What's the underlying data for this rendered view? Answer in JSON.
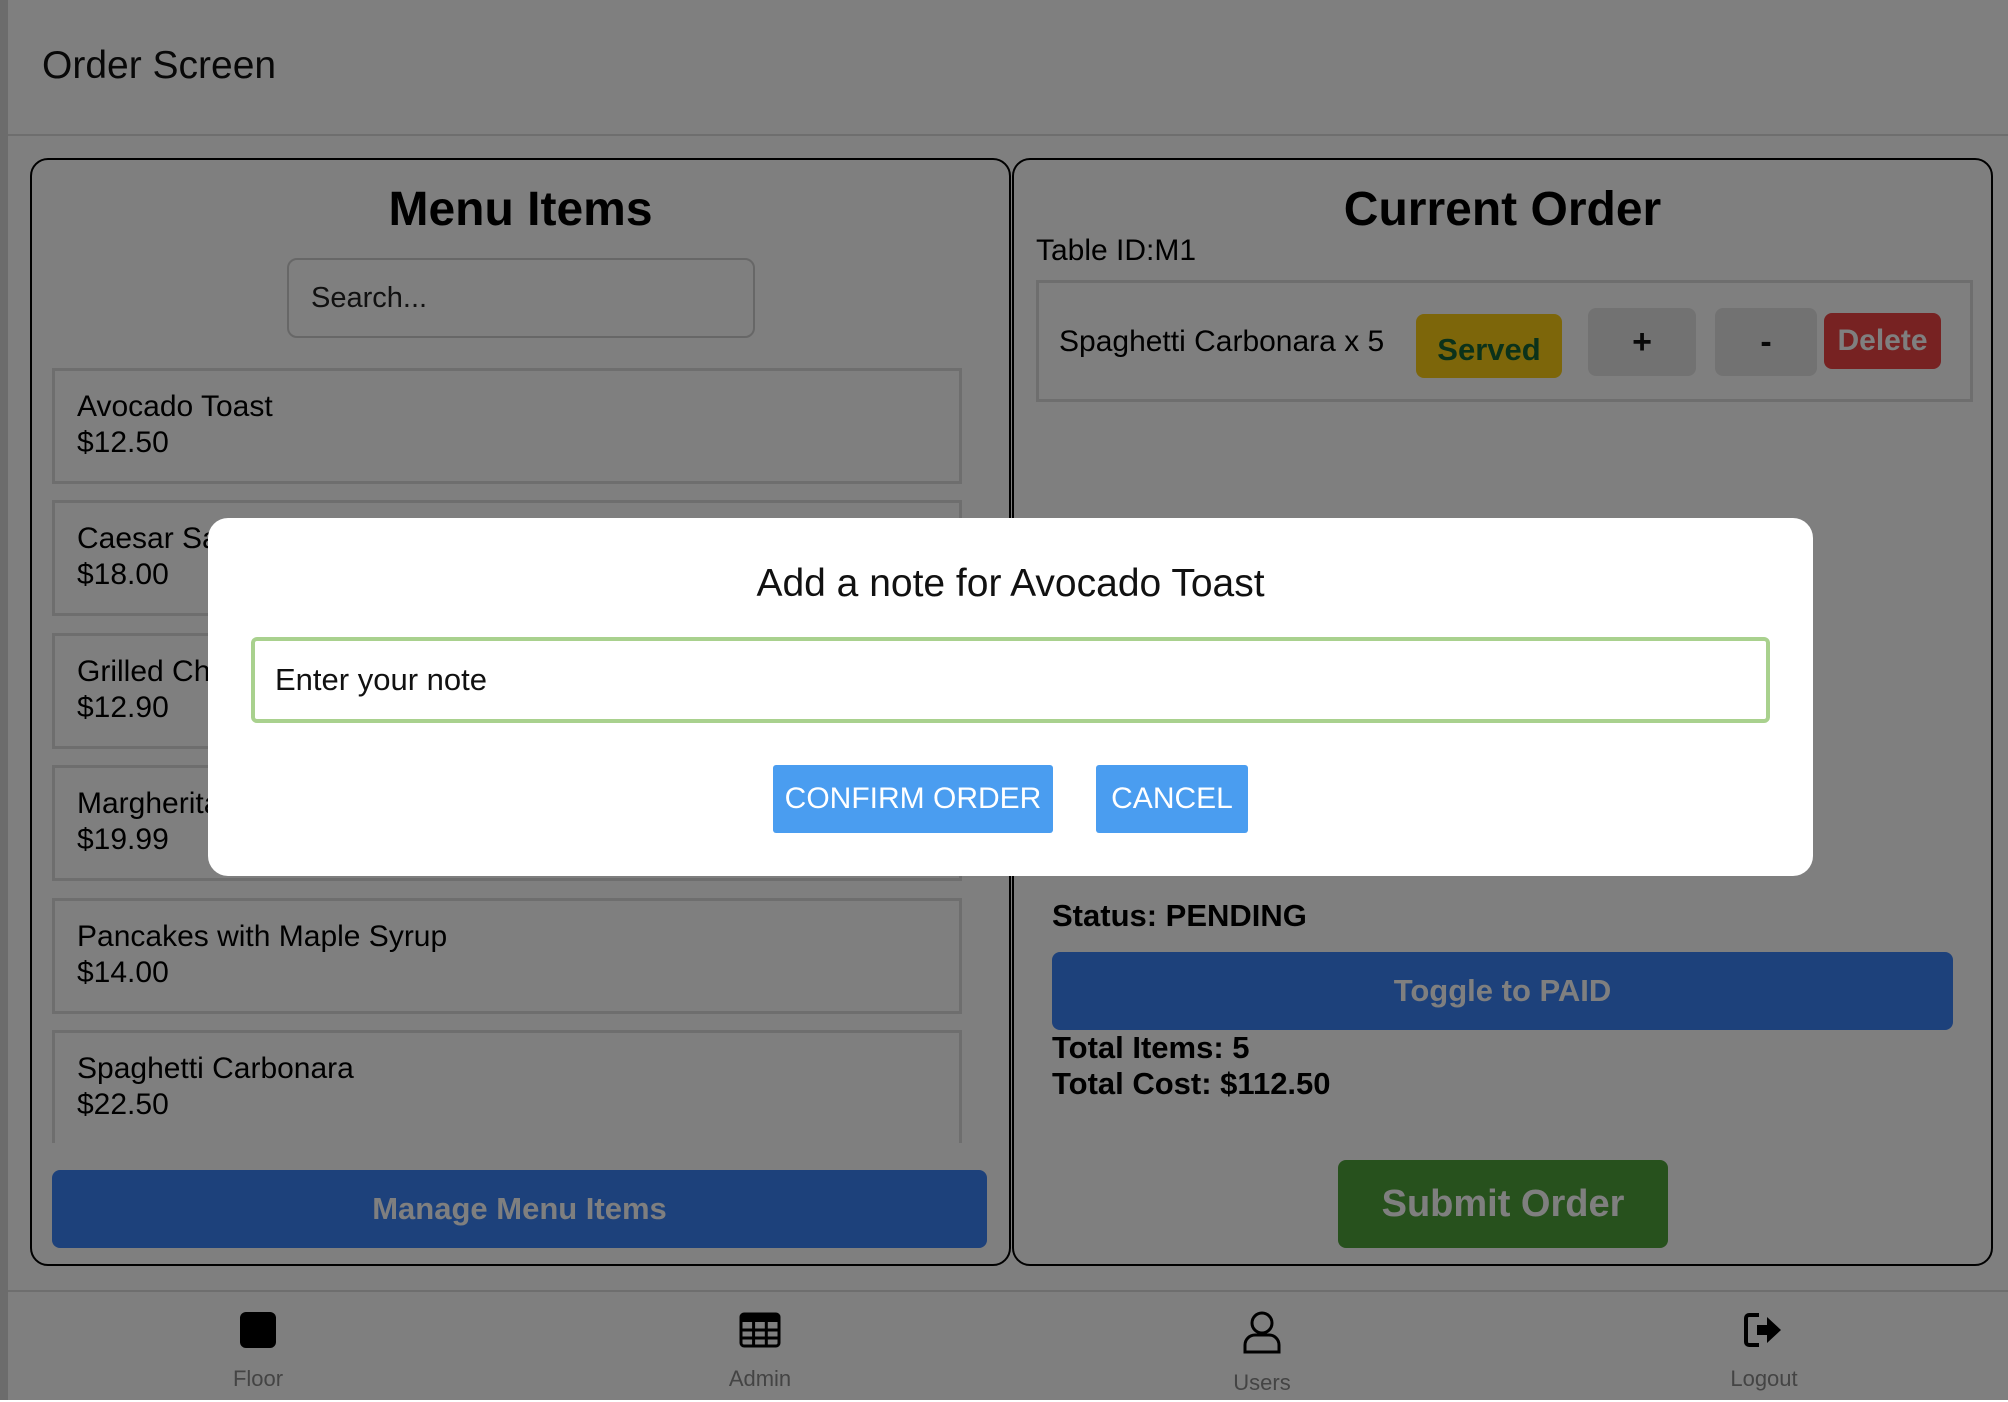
{
  "header": {
    "title": "Order Screen"
  },
  "menu": {
    "heading": "Menu Items",
    "search_placeholder": "Search...",
    "items": [
      {
        "name": "Avocado Toast",
        "price": "$12.50"
      },
      {
        "name": "Caesar Salad",
        "price": "$18.00"
      },
      {
        "name": "Grilled Chicken",
        "price": "$12.90"
      },
      {
        "name": "Margherita Pizza",
        "price": "$19.99"
      },
      {
        "name": "Pancakes with Maple Syrup",
        "price": "$14.00"
      },
      {
        "name": "Spaghetti Carbonara",
        "price": "$22.50"
      }
    ],
    "manage_label": "Manage Menu Items"
  },
  "order": {
    "heading": "Current Order",
    "table_id": "Table ID:M1",
    "lines": [
      {
        "item": "Spaghetti Carbonara x 5",
        "status": "Served",
        "plus": "+",
        "minus": "-",
        "delete": "Delete"
      }
    ],
    "status": "Status: PENDING",
    "toggle_label": "Toggle to PAID",
    "total_items": "Total Items: 5",
    "total_cost": "Total Cost: $112.50",
    "submit_label": "Submit Order"
  },
  "nav": [
    {
      "label": "Floor",
      "icon": "square-icon"
    },
    {
      "label": "Admin",
      "icon": "table-icon"
    },
    {
      "label": "Users",
      "icon": "user-icon"
    },
    {
      "label": "Logout",
      "icon": "logout-icon"
    }
  ],
  "dialog": {
    "title": "Add a note for Avocado Toast",
    "input_placeholder": "Enter your note",
    "confirm_label": "CONFIRM ORDER",
    "cancel_label": "CANCEL"
  },
  "colors": {
    "primary": "#3b82f6",
    "dialog_button": "#4a9df0",
    "served_badge": "#facc15",
    "served_text": "#166534",
    "delete": "#ef4444",
    "submit": "#4ea33a",
    "input_focus_border": "#a9d18e"
  }
}
